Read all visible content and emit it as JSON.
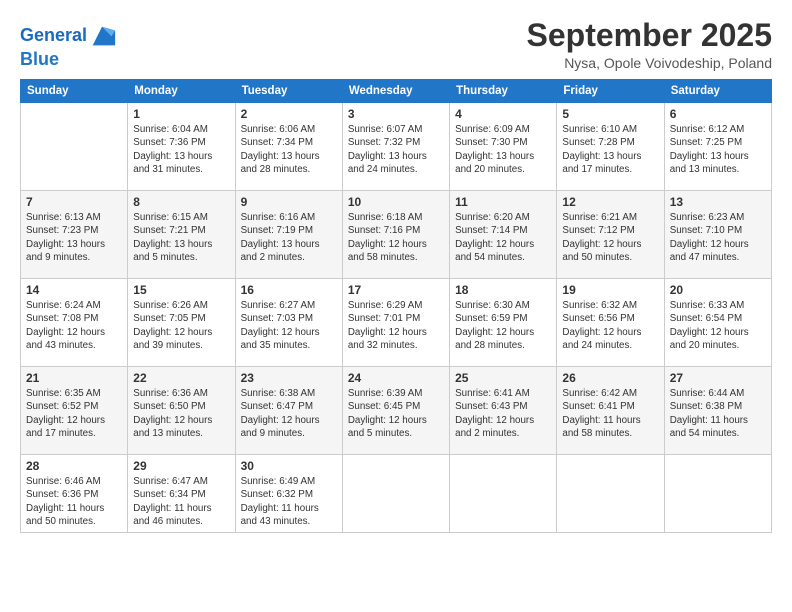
{
  "logo": {
    "line1": "General",
    "line2": "Blue"
  },
  "title": "September 2025",
  "subtitle": "Nysa, Opole Voivodeship, Poland",
  "days_header": [
    "Sunday",
    "Monday",
    "Tuesday",
    "Wednesday",
    "Thursday",
    "Friday",
    "Saturday"
  ],
  "weeks": [
    [
      {
        "day": "",
        "sunrise": "",
        "sunset": "",
        "daylight": ""
      },
      {
        "day": "1",
        "sunrise": "Sunrise: 6:04 AM",
        "sunset": "Sunset: 7:36 PM",
        "daylight": "Daylight: 13 hours and 31 minutes."
      },
      {
        "day": "2",
        "sunrise": "Sunrise: 6:06 AM",
        "sunset": "Sunset: 7:34 PM",
        "daylight": "Daylight: 13 hours and 28 minutes."
      },
      {
        "day": "3",
        "sunrise": "Sunrise: 6:07 AM",
        "sunset": "Sunset: 7:32 PM",
        "daylight": "Daylight: 13 hours and 24 minutes."
      },
      {
        "day": "4",
        "sunrise": "Sunrise: 6:09 AM",
        "sunset": "Sunset: 7:30 PM",
        "daylight": "Daylight: 13 hours and 20 minutes."
      },
      {
        "day": "5",
        "sunrise": "Sunrise: 6:10 AM",
        "sunset": "Sunset: 7:28 PM",
        "daylight": "Daylight: 13 hours and 17 minutes."
      },
      {
        "day": "6",
        "sunrise": "Sunrise: 6:12 AM",
        "sunset": "Sunset: 7:25 PM",
        "daylight": "Daylight: 13 hours and 13 minutes."
      }
    ],
    [
      {
        "day": "7",
        "sunrise": "Sunrise: 6:13 AM",
        "sunset": "Sunset: 7:23 PM",
        "daylight": "Daylight: 13 hours and 9 minutes."
      },
      {
        "day": "8",
        "sunrise": "Sunrise: 6:15 AM",
        "sunset": "Sunset: 7:21 PM",
        "daylight": "Daylight: 13 hours and 5 minutes."
      },
      {
        "day": "9",
        "sunrise": "Sunrise: 6:16 AM",
        "sunset": "Sunset: 7:19 PM",
        "daylight": "Daylight: 13 hours and 2 minutes."
      },
      {
        "day": "10",
        "sunrise": "Sunrise: 6:18 AM",
        "sunset": "Sunset: 7:16 PM",
        "daylight": "Daylight: 12 hours and 58 minutes."
      },
      {
        "day": "11",
        "sunrise": "Sunrise: 6:20 AM",
        "sunset": "Sunset: 7:14 PM",
        "daylight": "Daylight: 12 hours and 54 minutes."
      },
      {
        "day": "12",
        "sunrise": "Sunrise: 6:21 AM",
        "sunset": "Sunset: 7:12 PM",
        "daylight": "Daylight: 12 hours and 50 minutes."
      },
      {
        "day": "13",
        "sunrise": "Sunrise: 6:23 AM",
        "sunset": "Sunset: 7:10 PM",
        "daylight": "Daylight: 12 hours and 47 minutes."
      }
    ],
    [
      {
        "day": "14",
        "sunrise": "Sunrise: 6:24 AM",
        "sunset": "Sunset: 7:08 PM",
        "daylight": "Daylight: 12 hours and 43 minutes."
      },
      {
        "day": "15",
        "sunrise": "Sunrise: 6:26 AM",
        "sunset": "Sunset: 7:05 PM",
        "daylight": "Daylight: 12 hours and 39 minutes."
      },
      {
        "day": "16",
        "sunrise": "Sunrise: 6:27 AM",
        "sunset": "Sunset: 7:03 PM",
        "daylight": "Daylight: 12 hours and 35 minutes."
      },
      {
        "day": "17",
        "sunrise": "Sunrise: 6:29 AM",
        "sunset": "Sunset: 7:01 PM",
        "daylight": "Daylight: 12 hours and 32 minutes."
      },
      {
        "day": "18",
        "sunrise": "Sunrise: 6:30 AM",
        "sunset": "Sunset: 6:59 PM",
        "daylight": "Daylight: 12 hours and 28 minutes."
      },
      {
        "day": "19",
        "sunrise": "Sunrise: 6:32 AM",
        "sunset": "Sunset: 6:56 PM",
        "daylight": "Daylight: 12 hours and 24 minutes."
      },
      {
        "day": "20",
        "sunrise": "Sunrise: 6:33 AM",
        "sunset": "Sunset: 6:54 PM",
        "daylight": "Daylight: 12 hours and 20 minutes."
      }
    ],
    [
      {
        "day": "21",
        "sunrise": "Sunrise: 6:35 AM",
        "sunset": "Sunset: 6:52 PM",
        "daylight": "Daylight: 12 hours and 17 minutes."
      },
      {
        "day": "22",
        "sunrise": "Sunrise: 6:36 AM",
        "sunset": "Sunset: 6:50 PM",
        "daylight": "Daylight: 12 hours and 13 minutes."
      },
      {
        "day": "23",
        "sunrise": "Sunrise: 6:38 AM",
        "sunset": "Sunset: 6:47 PM",
        "daylight": "Daylight: 12 hours and 9 minutes."
      },
      {
        "day": "24",
        "sunrise": "Sunrise: 6:39 AM",
        "sunset": "Sunset: 6:45 PM",
        "daylight": "Daylight: 12 hours and 5 minutes."
      },
      {
        "day": "25",
        "sunrise": "Sunrise: 6:41 AM",
        "sunset": "Sunset: 6:43 PM",
        "daylight": "Daylight: 12 hours and 2 minutes."
      },
      {
        "day": "26",
        "sunrise": "Sunrise: 6:42 AM",
        "sunset": "Sunset: 6:41 PM",
        "daylight": "Daylight: 11 hours and 58 minutes."
      },
      {
        "day": "27",
        "sunrise": "Sunrise: 6:44 AM",
        "sunset": "Sunset: 6:38 PM",
        "daylight": "Daylight: 11 hours and 54 minutes."
      }
    ],
    [
      {
        "day": "28",
        "sunrise": "Sunrise: 6:46 AM",
        "sunset": "Sunset: 6:36 PM",
        "daylight": "Daylight: 11 hours and 50 minutes."
      },
      {
        "day": "29",
        "sunrise": "Sunrise: 6:47 AM",
        "sunset": "Sunset: 6:34 PM",
        "daylight": "Daylight: 11 hours and 46 minutes."
      },
      {
        "day": "30",
        "sunrise": "Sunrise: 6:49 AM",
        "sunset": "Sunset: 6:32 PM",
        "daylight": "Daylight: 11 hours and 43 minutes."
      },
      {
        "day": "",
        "sunrise": "",
        "sunset": "",
        "daylight": ""
      },
      {
        "day": "",
        "sunrise": "",
        "sunset": "",
        "daylight": ""
      },
      {
        "day": "",
        "sunrise": "",
        "sunset": "",
        "daylight": ""
      },
      {
        "day": "",
        "sunrise": "",
        "sunset": "",
        "daylight": ""
      }
    ]
  ]
}
